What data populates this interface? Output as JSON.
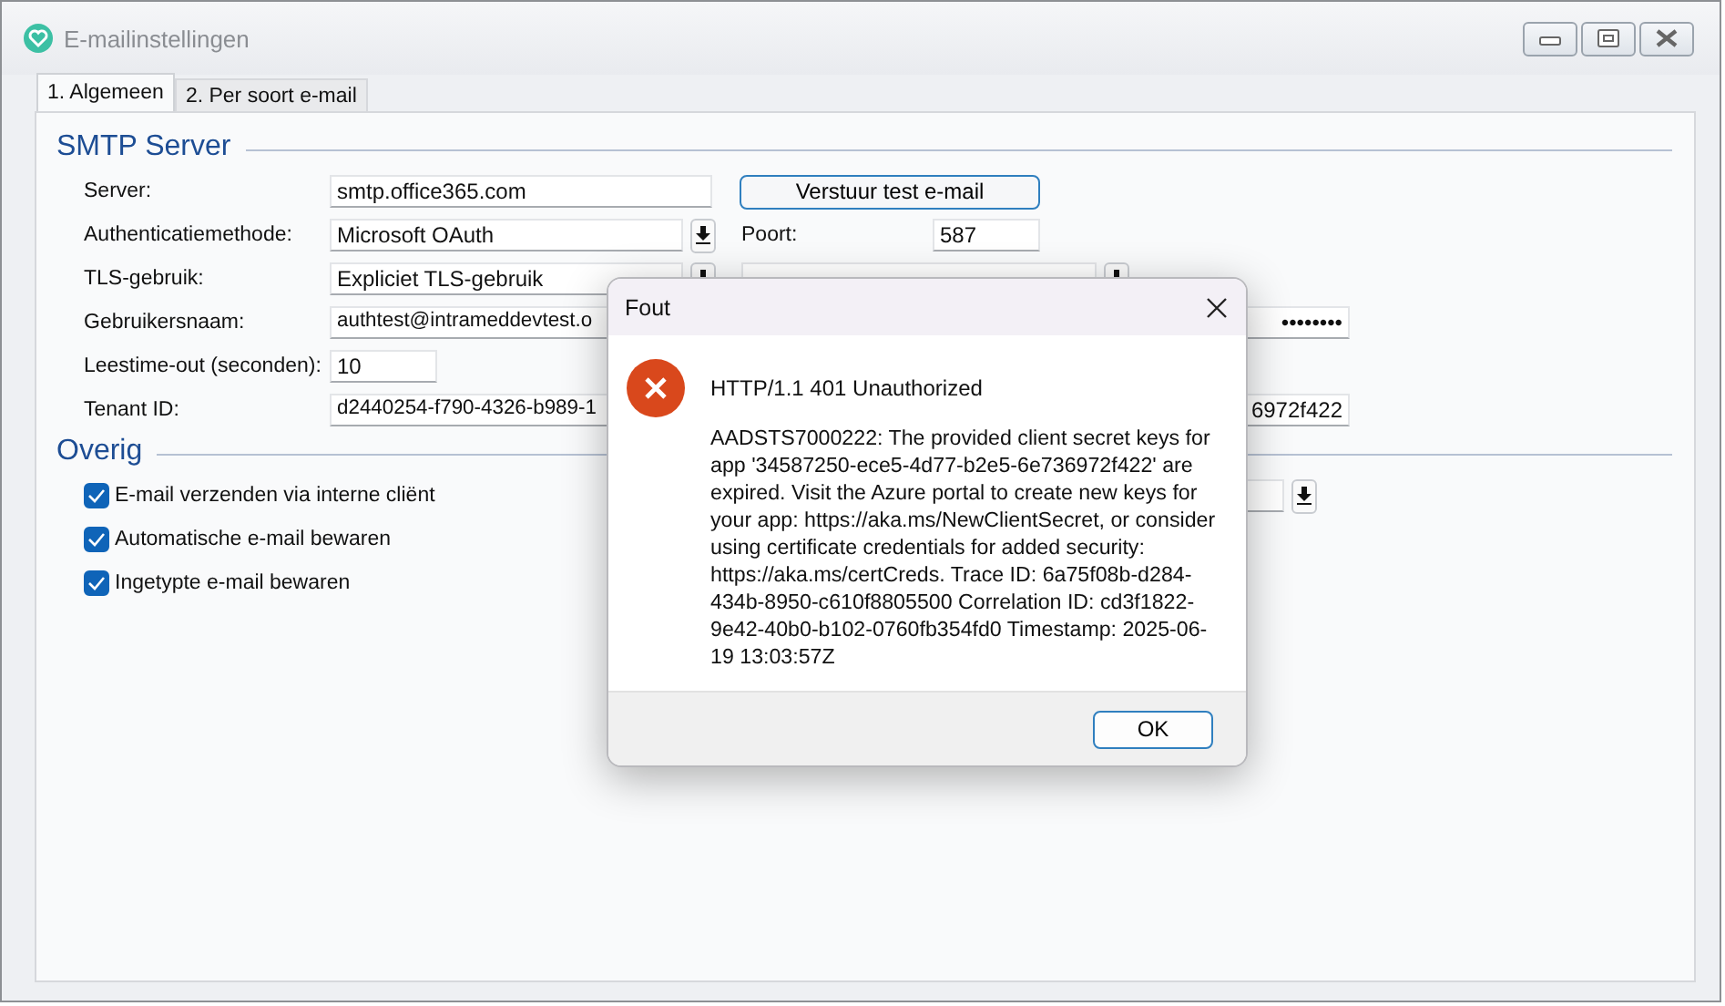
{
  "window": {
    "title": "E-mailinstellingen"
  },
  "tabs": [
    {
      "label": "1. Algemeen",
      "selected": true
    },
    {
      "label": "2. Per soort e-mail",
      "selected": false
    }
  ],
  "smtp": {
    "heading": "SMTP Server",
    "rows": [
      {
        "label": "Server:",
        "field": {
          "kind": "text",
          "value": "smtp.office365.com"
        },
        "right": {
          "kind": "button",
          "label": "Verstuur test e-mail"
        }
      },
      {
        "label": "Authenticatiemethode:",
        "field": {
          "kind": "dropdown",
          "value": "Microsoft OAuth"
        },
        "right": {
          "kind": "short",
          "label": "Poort:",
          "value": "587"
        }
      },
      {
        "label": "TLS-gebruik:",
        "field": {
          "kind": "dropdown",
          "value": "Expliciet TLS-gebruik"
        },
        "right": {
          "kind": "dropdown"
        }
      },
      {
        "label": "Gebruikersnaam:",
        "field": {
          "kind": "wide",
          "value": "authtest@intrameddevtest.o"
        },
        "right": {
          "kind": "password",
          "value": "••••••••"
        }
      },
      {
        "label": "Leestime-out (seconden):",
        "field": {
          "kind": "short",
          "value": "10"
        }
      },
      {
        "label": "Tenant ID:",
        "field": {
          "kind": "wide",
          "value": "d2440254-f790-4326-b989-1"
        },
        "right": {
          "kind": "tail",
          "value": "6972f422"
        }
      }
    ]
  },
  "overig": {
    "heading": "Overig",
    "checkboxes": [
      {
        "label": "E-mail verzenden via interne cliënt",
        "checked": true
      },
      {
        "label": "Automatische e-mail bewaren",
        "checked": true
      },
      {
        "label": "Ingetypte e-mail bewaren",
        "checked": true
      }
    ],
    "right": {
      "kind": "dropdown"
    }
  },
  "dialog": {
    "title": "Fout",
    "heading": "HTTP/1.1 401 Unauthorized",
    "message": "AADSTS7000222: The provided client secret keys for app '34587250-ece5-4d77-b2e5-6e736972f422' are expired. Visit the Azure portal to create new keys for your app: https://aka.ms/NewClientSecret, or consider using certificate credentials for added security: https://aka.ms/certCreds. Trace ID: 6a75f08b-d284-434b-8950-c610f8805500 Correlation ID: cd3f1822-9e42-40b0-b102-0760fb354fd0 Timestamp: 2025-06-19 13:03:57Z",
    "button": "OK"
  }
}
